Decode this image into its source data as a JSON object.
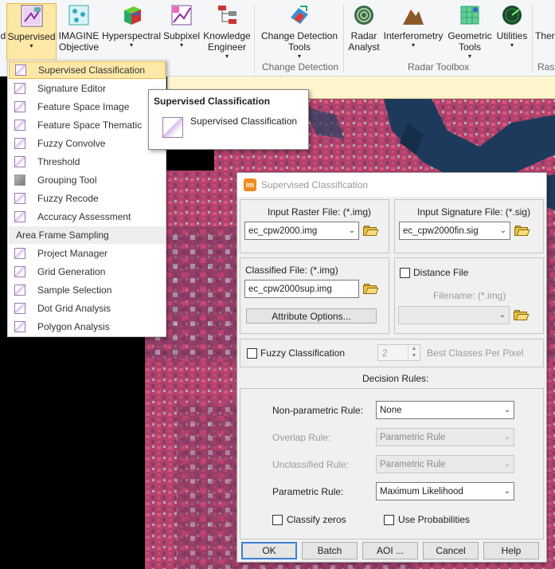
{
  "ribbon": {
    "buttons": [
      {
        "label": "d",
        "arrow": ""
      },
      {
        "label": "Supervised",
        "arrow": "▾"
      },
      {
        "label": "IMAGINE Objective",
        "arrow": ""
      },
      {
        "label": "Hyperspectral",
        "arrow": "▾"
      },
      {
        "label": "Subpixel",
        "arrow": "▾"
      },
      {
        "label": "Knowledge Engineer",
        "arrow": "▾"
      },
      {
        "label": "Change Detection Tools",
        "arrow": "▾"
      },
      {
        "label": "Radar Analyst",
        "arrow": ""
      },
      {
        "label": "Interferometry",
        "arrow": "▾"
      },
      {
        "label": "Geometric Tools",
        "arrow": "▾"
      },
      {
        "label": "Utilities",
        "arrow": "▾"
      },
      {
        "label": "Ther",
        "arrow": ""
      }
    ],
    "groups": [
      "Change Detection",
      "Radar Toolbox",
      "Rast"
    ]
  },
  "menu": {
    "items": [
      "Supervised Classification",
      "Signature Editor",
      "Feature Space Image",
      "Feature Space Thematic",
      "Fuzzy Convolve",
      "Threshold",
      "Grouping Tool",
      "Fuzzy Recode",
      "Accuracy Assessment"
    ],
    "section": "Area Frame Sampling",
    "section_items": [
      "Project Manager",
      "Grid Generation",
      "Sample Selection",
      "Dot Grid Analysis",
      "Polygon Analysis"
    ]
  },
  "tooltip": {
    "title": "Supervised Classification",
    "text": "Supervised Classification"
  },
  "dialog": {
    "title": "Supervised Classification",
    "input_raster_label": "Input Raster File: (*.img)",
    "input_raster_value": "ec_cpw2000.img",
    "input_signature_label": "Input Signature File: (*.sig)",
    "input_signature_value": "ec_cpw2000fin.sig",
    "classified_label": "Classified File: (*.img)",
    "classified_value": "ec_cpw2000sup.img",
    "attribute_options": "Attribute Options...",
    "distance_file_label": "Distance File",
    "filename_label": "Filename: (*.img)",
    "filename_value": "",
    "fuzzy_label": "Fuzzy Classification",
    "fuzzy_value": "2",
    "best_classes_label": "Best Classes Per Pixel",
    "decision_rules_label": "Decision Rules:",
    "nonparametric_label": "Non-parametric Rule:",
    "nonparametric_value": "None",
    "overlap_label": "Overlap Rule:",
    "overlap_value": "Parametric Rule",
    "unclassified_label": "Unclassified Rule:",
    "unclassified_value": "Parametric Rule",
    "parametric_label": "Parametric Rule:",
    "parametric_value": "Maximum Likelihood",
    "classify_zeros_label": "Classify zeros",
    "use_probabilities_label": "Use Probabilities",
    "buttons": {
      "ok": "OK",
      "batch": "Batch",
      "aoi": "AOI ...",
      "cancel": "Cancel",
      "help": "Help"
    }
  },
  "colors": {
    "highlight": "#fde8a8",
    "ribbon_bg": "#f5f6f7",
    "imagery_magenta": "#c8426e",
    "imagery_water": "#1d3a5c"
  }
}
